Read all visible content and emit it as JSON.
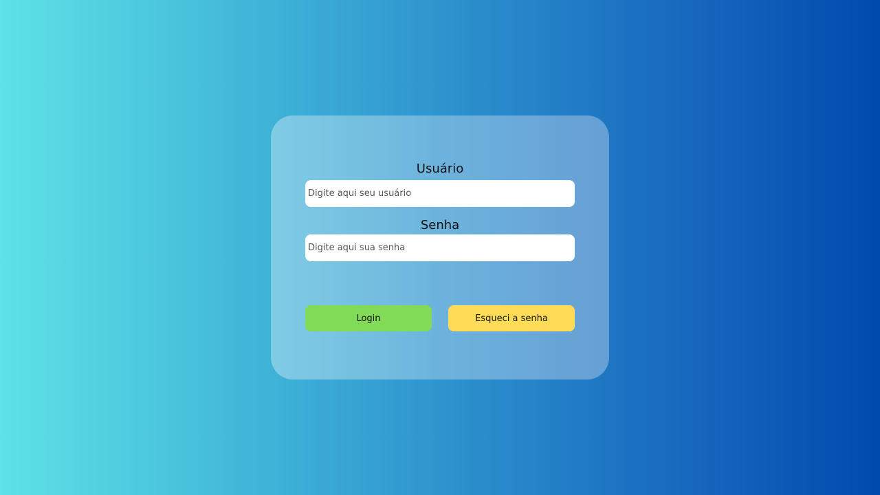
{
  "colors": {
    "background_start": "#5ee2e6",
    "background_end": "#004aad",
    "login_button": "#82db57",
    "forgot_button": "#ffdc57"
  },
  "form": {
    "username_label": "Usuário",
    "username_placeholder": "Digite aqui seu usuário",
    "username_value": "",
    "password_label": "Senha",
    "password_placeholder": "Digite aqui sua senha",
    "password_value": ""
  },
  "actions": {
    "login_label": "Login",
    "forgot_label": "Esqueci a senha"
  }
}
